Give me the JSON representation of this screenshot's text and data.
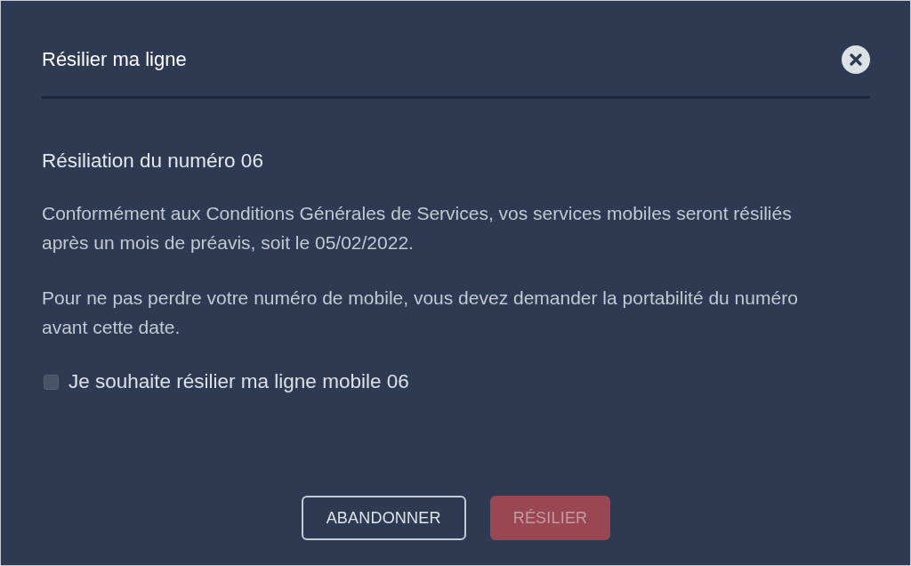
{
  "dialog": {
    "title": "Résilier ma ligne"
  },
  "heading": "Résiliation du numéro 06",
  "paragraphs": [
    "Conformément aux Conditions Générales de Services, vos services mobiles seront résiliés après un mois de préavis, soit le 05/02/2022.",
    "Pour ne pas perdre votre numéro de mobile, vous devez demander la portabilité du numéro avant cette date."
  ],
  "checkbox": {
    "label": "Je souhaite résilier ma ligne mobile 06",
    "checked": false
  },
  "buttons": [
    {
      "label": "ABANDONNER",
      "kind": "outline",
      "disabled": false
    },
    {
      "label": "RÉSILIER",
      "kind": "danger",
      "disabled": true
    }
  ]
}
